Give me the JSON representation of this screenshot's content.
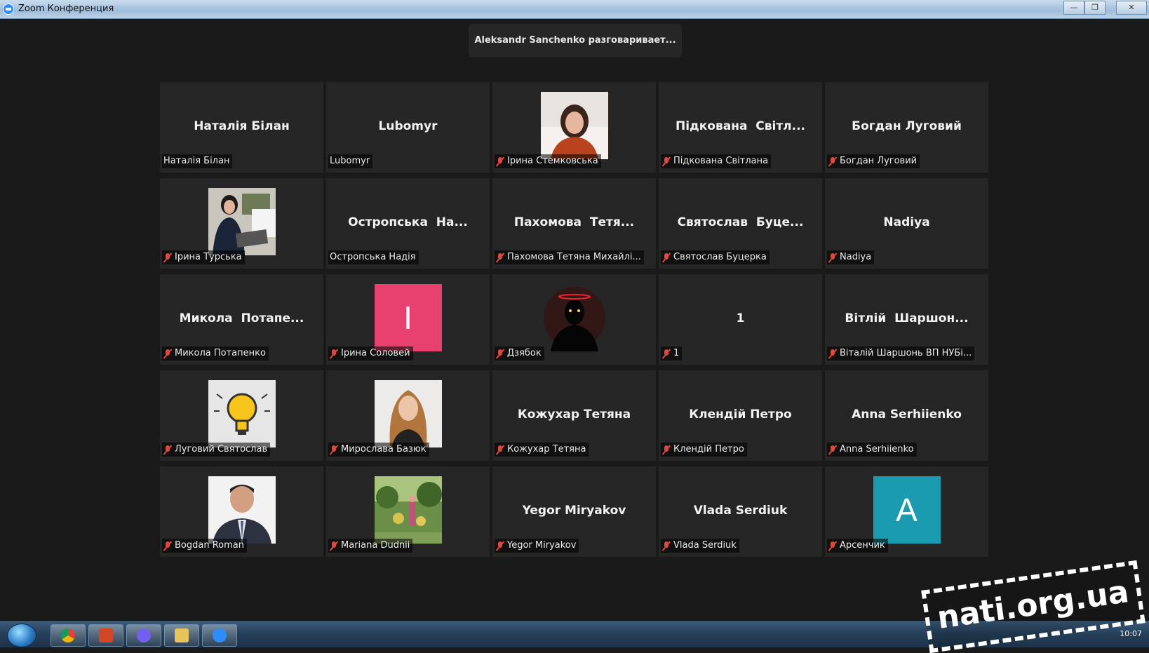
{
  "window": {
    "title": "Zoom Конференция",
    "buttons": [
      "—",
      "❐",
      "✕"
    ]
  },
  "speaking_banner": "Aleksandr Sanchenko разговаривает...",
  "tiles": [
    {
      "display": "Наталія Білан",
      "label": "Наталія Білан",
      "muted": false
    },
    {
      "display": "Lubomyr",
      "label": "Lubomyr",
      "muted": false
    },
    {
      "display": "",
      "label": "Ірина Стемковська",
      "muted": true,
      "avatar": "photo-woman-red"
    },
    {
      "display": "Підкована  Світл...",
      "label": "Підкована Світлана",
      "muted": true
    },
    {
      "display": "Богдан Луговий",
      "label": "Богдан Луговий",
      "muted": true
    },
    {
      "display": "",
      "label": "Ірина Турська",
      "muted": true,
      "avatar": "photo-woman-laptop"
    },
    {
      "display": "Остропська  На...",
      "label": "Остропська Надія",
      "muted": false
    },
    {
      "display": "Пахомова  Тетя...",
      "label": "Пахомова Тетяна Михайлі...",
      "muted": true
    },
    {
      "display": "Святослав  Буце...",
      "label": "Святослав Буцерка",
      "muted": true
    },
    {
      "display": "Nadiya",
      "label": "Nadiya",
      "muted": true
    },
    {
      "display": "Микола  Потапе...",
      "label": "Микола Потапенко",
      "muted": true
    },
    {
      "display": "",
      "label": "Ірина Соловей",
      "muted": true,
      "avatar": "letter",
      "letter": "І",
      "avatar_color": "#e8416f"
    },
    {
      "display": "",
      "label": "Дзябок",
      "muted": true,
      "avatar": "dark-figure"
    },
    {
      "display": "1",
      "label": "1",
      "muted": true
    },
    {
      "display": "Вiтлiй  Шаршон...",
      "label": "Віталій Шаршонь ВП НУБі...",
      "muted": true
    },
    {
      "display": "",
      "label": "Луговий Святослав",
      "muted": true,
      "avatar": "lightbulb"
    },
    {
      "display": "",
      "label": "Мирослава Базюк",
      "muted": true,
      "avatar": "photo-woman-blonde"
    },
    {
      "display": "Кожухар Тетяна",
      "label": "Кожухар Тетяна",
      "muted": true
    },
    {
      "display": "Клендій Петро",
      "label": "Клендій Петро",
      "muted": true
    },
    {
      "display": "Anna Serhiienko",
      "label": "Anna Serhiienko",
      "muted": true
    },
    {
      "display": "",
      "label": "Bogdan Roman",
      "muted": true,
      "avatar": "photo-man-suit"
    },
    {
      "display": "",
      "label": "Mariana Dudnii",
      "muted": true,
      "avatar": "photo-garden"
    },
    {
      "display": "Yegor Miryakov",
      "label": "Yegor Miryakov",
      "muted": true
    },
    {
      "display": "Vlada Serdiuk",
      "label": "Vlada Serdiuk",
      "muted": true
    },
    {
      "display": "",
      "label": "Арсенчик",
      "muted": true,
      "avatar": "letter",
      "letter": "A",
      "avatar_color": "#1a9bb0"
    }
  ],
  "taskbar": {
    "items": [
      "chrome-icon",
      "powerpoint-icon",
      "viber-icon",
      "explorer-icon",
      "zoom-icon"
    ],
    "clock": "10:07"
  },
  "watermark": "nati.org.ua"
}
